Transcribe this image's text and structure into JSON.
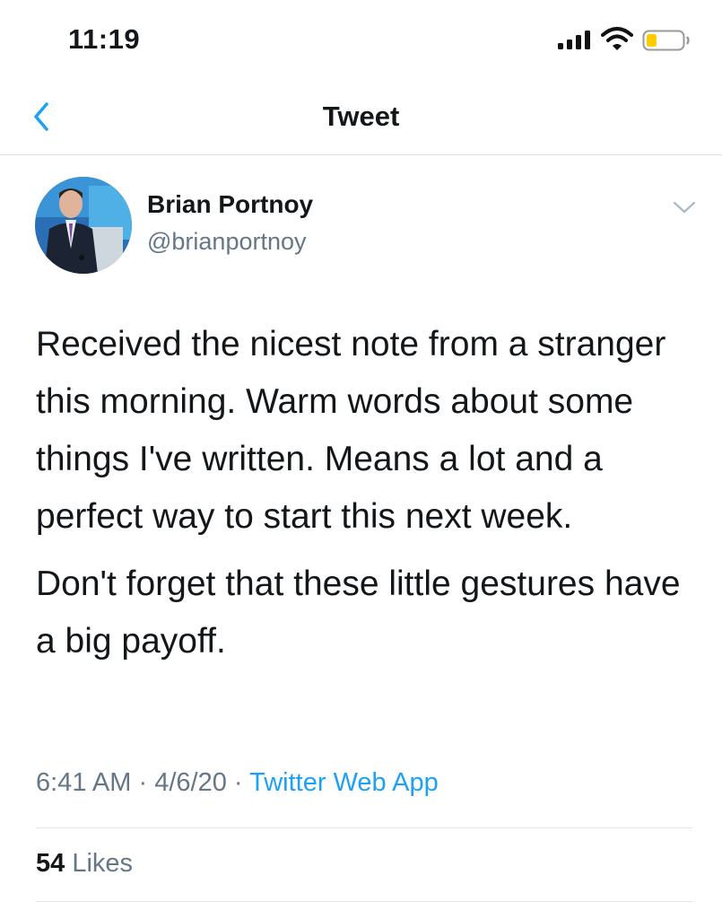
{
  "status_bar": {
    "time": "11:19",
    "icons": [
      "cellular-signal-icon",
      "wifi-icon",
      "battery-low-icon"
    ]
  },
  "nav": {
    "back_icon": "chevron-left-icon",
    "title": "Tweet"
  },
  "tweet": {
    "author": {
      "name": "Brian Portnoy",
      "handle": "@brianportnoy"
    },
    "menu_icon": "chevron-down-icon",
    "text": [
      "Received the nicest note from a stranger this morning. Warm words about some things I've written. Means a lot and a perfect way to start this next week.",
      "Don't forget that these little gestures have a big payoff."
    ],
    "time": "6:41 AM",
    "date": "4/6/20",
    "dot": "·",
    "source": "Twitter Web App",
    "likes": {
      "count": "54",
      "label": "Likes"
    }
  },
  "colors": {
    "accent": "#1da1f2",
    "text": "#14171a",
    "secondary": "#657786",
    "battery_low": "#ffcc00"
  }
}
